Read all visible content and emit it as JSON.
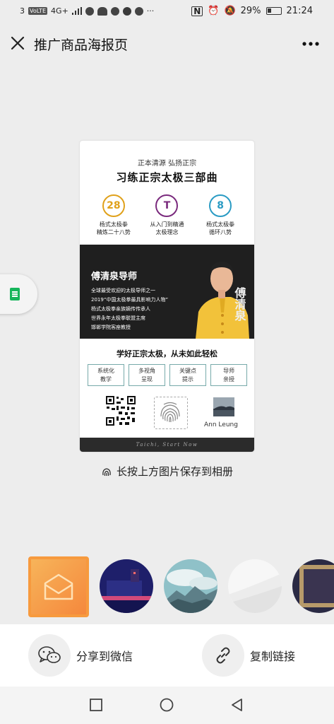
{
  "status": {
    "sim": "3",
    "volte": "VoLTE",
    "network": "4G+",
    "battery": "29%",
    "time": "21:24"
  },
  "header": {
    "title": "推广商品海报页",
    "close_icon": "close-icon",
    "more_icon": "more-icon"
  },
  "poster": {
    "subtitle": "正本清源 弘扬正宗",
    "title": "习练正宗太极三部曲",
    "features": [
      {
        "badge": "28",
        "line1": "杨式太极拳",
        "line2": "精炼二十八势",
        "color": "#e0a11b"
      },
      {
        "badge": "T",
        "line1": "从入门到精通",
        "line2": "太极理念",
        "color": "#7a2a7d"
      },
      {
        "badge": "8",
        "line1": "杨式太极拳",
        "line2": "循环八势",
        "color": "#2a9bc4"
      }
    ],
    "teacher_name": "傅清泉导师",
    "bio": [
      "全球最受欢迎的太极导师之一",
      "2019“中国太极拳最具影响力人物”",
      "杨式太极拳亲族嫡传传承人",
      "世界永年太极拳联盟主席",
      "邯郸学院客座教授"
    ],
    "slogan": "学好正宗太极，从未如此轻松",
    "tags": [
      {
        "line1": "系统化",
        "line2": "教学"
      },
      {
        "line1": "多视角",
        "line2": "呈现"
      },
      {
        "line1": "关键点",
        "line2": "提示"
      },
      {
        "line1": "导师",
        "line2": "亲授"
      }
    ],
    "author": "Ann Leung",
    "footer": "Taichi, Start Now"
  },
  "save_hint": "长按上方图片保存到相册",
  "actions": {
    "share_wechat": "分享到微信",
    "copy_link": "复制链接"
  },
  "colors": {
    "accent": "#f79a3e",
    "background": "#ededed",
    "wechat_green": "#15b55a"
  }
}
